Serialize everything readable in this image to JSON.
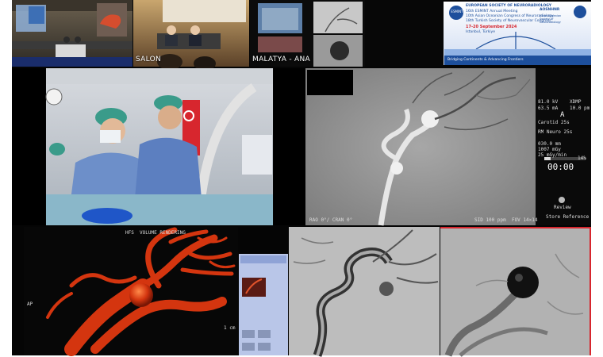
{
  "top_strip": {
    "room_label": "SALON",
    "city_label": "MALATYA - ANA"
  },
  "conference_banner": {
    "org_badge": "ESMINT",
    "org_title": "EUROPEAN SOCIETY OF NEURORADIOLOGY",
    "meeting_line1": "16th ESMINT Annual Meeting",
    "meeting_line2": "10th Asian Oceanian Congress of Neuroradiology",
    "meeting_line3": "18th Turkish Society of Neurovascular Congress",
    "dates": "17-20 September 2024",
    "city": "Istanbul, Türkiye",
    "tagline": "Bridging Continents & Advancing Frontiers",
    "right_badge": "AOSNHNR",
    "right_text": "Asian Oceanian Society of Neuroradiology"
  },
  "angio_monitor": {
    "kv": "81.0 kV",
    "ma": "63.5 mA",
    "mode": "XDMP",
    "fov": "10.0 pm",
    "plane": "A",
    "carotid": "Carotid 25s",
    "neuro": "RM Neuro 25s",
    "dose1": "030.0 mm",
    "dose2": "1007 mGy",
    "dose3": "25 mGy/min",
    "timer": "00:00",
    "percent": "14%",
    "review": "Review",
    "store": "Store Reference",
    "bottom_left": "RAO 0°/ CRAN 0°",
    "bottom_right": "SID 100 ppm  FOV 14×14"
  },
  "volume_render": {
    "header": "HFS  VOLUME RENDERING",
    "scale": "1 cm",
    "side_label": "AP"
  },
  "colors": {
    "vessel_red": "#d4350f",
    "banner_blue": "#1d4f9c",
    "flag_red": "#d7262e"
  }
}
